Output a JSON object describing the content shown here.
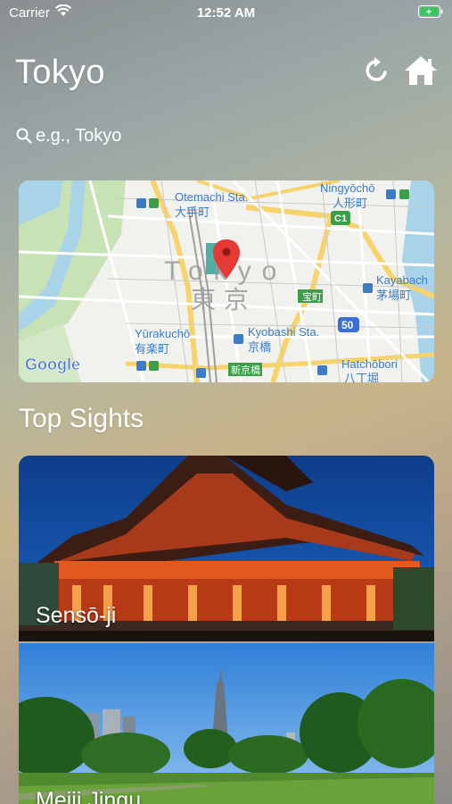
{
  "status_bar": {
    "carrier": "Carrier",
    "time": "12:52 AM"
  },
  "header": {
    "title": "Tokyo"
  },
  "search": {
    "placeholder": "e.g., Tokyo"
  },
  "map": {
    "city_label": "Tokyo",
    "city_label_jp": "東 京",
    "provider": "Google",
    "labels": {
      "otemachi": "Otemachi Sta.",
      "otemachi_jp": "大手町",
      "ningyocho": "Ningyōchō",
      "ningyocho_jp": "人形町",
      "kayabacho": "Kayabach",
      "kayabacho_jp": "茅場町",
      "yurakucho": "Yūrakuchō",
      "yurakucho_jp": "有楽町",
      "kyobashi": "Kyobashi Sta.",
      "kyobashi_jp": "京橋",
      "hatchobori": "Hatchōbori",
      "hatchobori_jp": "八丁堀",
      "takaracho": "宝町",
      "shinkyobashi": "新京橋",
      "route_c1": "C1",
      "route_50": "50"
    }
  },
  "sights": {
    "title": "Top Sights",
    "items": [
      {
        "name": "Sensō-ji"
      },
      {
        "name": "Meiji Jingu"
      }
    ]
  },
  "colors": {
    "accent": "#ffffff",
    "pin": "#e53935",
    "water": "#a9d3e8",
    "park": "#c7e3b6"
  }
}
